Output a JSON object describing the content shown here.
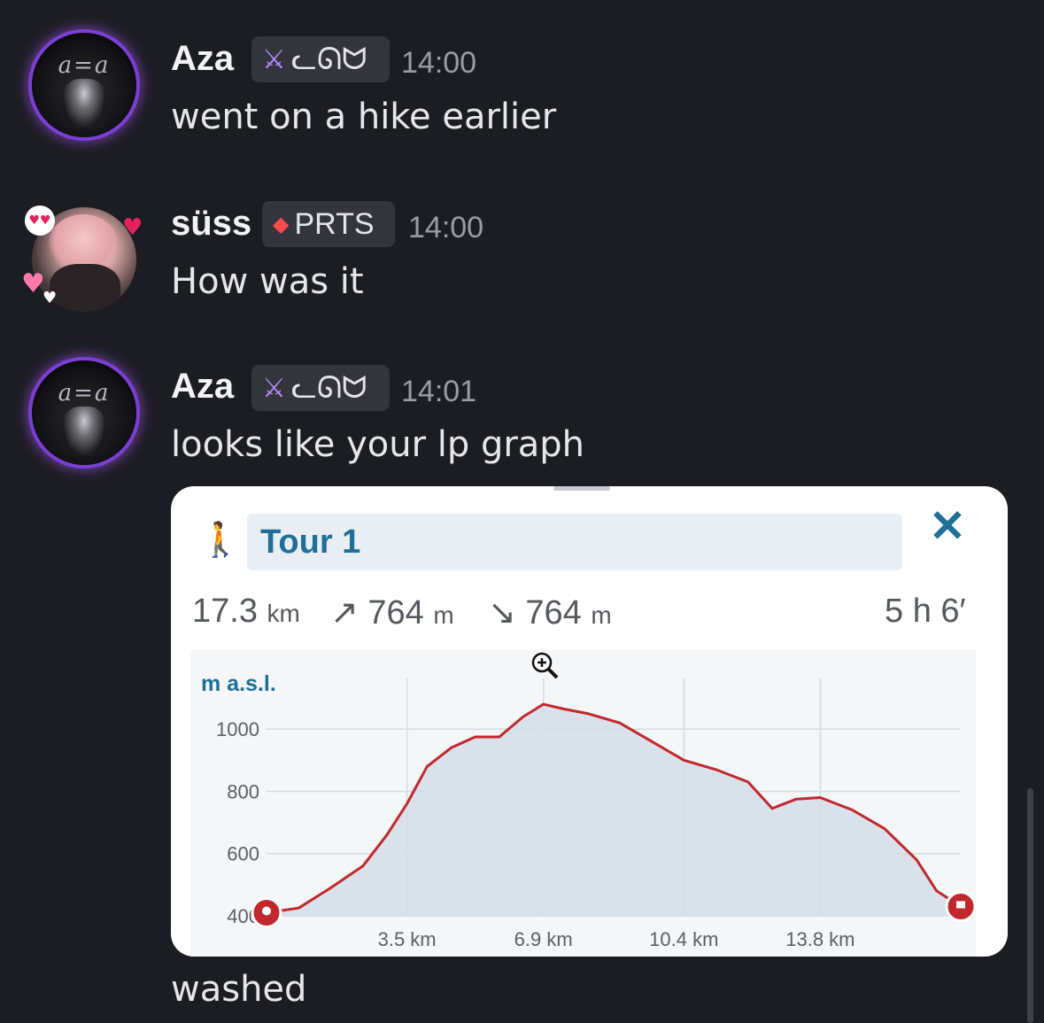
{
  "messages": [
    {
      "author": "Aza",
      "tag": "ᓚᘏᗢ",
      "time": "14:00",
      "text": "went on a hike earlier"
    },
    {
      "author": "süss",
      "tag": "PRTS",
      "time": "14:00",
      "text": "How was it"
    },
    {
      "author": "Aza",
      "tag": "ᓚᘏᗢ",
      "time": "14:01",
      "text": "looks like your lp graph"
    }
  ],
  "final_text": "washed",
  "icons": {
    "sword": "sword-icon",
    "prts": "diamond-icon",
    "hiker": "hiker-icon",
    "close": "close-icon",
    "zoom": "zoom-in-icon",
    "start": "location-pin-icon",
    "end": "flag-icon"
  },
  "avatar_text": "a=a",
  "tour": {
    "title": "Tour 1",
    "distance": "17.3",
    "distance_unit": "km",
    "ascent_symbol": "↗",
    "ascent": "764",
    "ascent_unit": "m",
    "descent_symbol": "↘",
    "descent": "764",
    "descent_unit": "m",
    "duration": "5 h 6′"
  },
  "colors": {
    "line": "#c0282d",
    "area": "#d3dee8",
    "accent": "#1f6f99",
    "tag_bg": "#34353c",
    "aza_glow": "#7b3fd6"
  },
  "chart_data": {
    "type": "area",
    "ylabel": "m a.s.l.",
    "xlabel": "",
    "x_ticks": [
      "3.5 km",
      "6.9 km",
      "10.4 km",
      "13.8 km"
    ],
    "y_ticks": [
      "1000",
      "800",
      "600",
      "400"
    ],
    "xlim": [
      0,
      17.3
    ],
    "ylim": [
      400,
      1140
    ],
    "grid": true,
    "x": [
      0,
      0.8,
      1.6,
      2.4,
      3.0,
      3.5,
      4.0,
      4.6,
      5.2,
      5.8,
      6.4,
      6.9,
      7.4,
      8.0,
      8.8,
      9.6,
      10.4,
      11.2,
      12.0,
      12.6,
      13.2,
      13.8,
      14.6,
      15.4,
      16.2,
      16.7,
      17.3
    ],
    "series": [
      {
        "values": [
          410,
          425,
          490,
          560,
          660,
          760,
          880,
          940,
          975,
          975,
          1040,
          1080,
          1065,
          1050,
          1020,
          960,
          900,
          870,
          830,
          745,
          775,
          780,
          740,
          680,
          580,
          480,
          430
        ]
      }
    ]
  }
}
